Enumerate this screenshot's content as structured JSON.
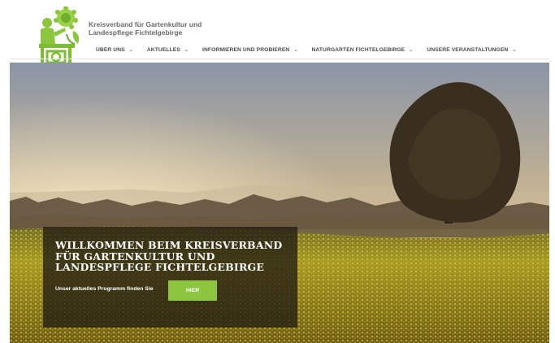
{
  "site": {
    "title_line1": "Kreisverband für Gartenkultur und",
    "title_line2": "Landespflege Fichtelgebirge"
  },
  "nav": {
    "items": [
      {
        "label": "ÜBER UNS"
      },
      {
        "label": "AKTUELLES"
      },
      {
        "label": "INFORMIEREN UND PROBIEREN"
      },
      {
        "label": "NATURGARTEN FICHTELGEBIRGE"
      },
      {
        "label": "UNSERE VERANSTALTUNGEN"
      }
    ],
    "chevron": "⌄"
  },
  "hero": {
    "welcome_title": "WILLKOMMEN BEIM KREISVERBAND FÜR GARTENKULTUR UND LANDESPFLEGE FICHTELGEBIRGE",
    "promo_text": "Unser aktuelles Programm finden Sie",
    "button_label": "HIER"
  },
  "colors": {
    "accent": "#8cc63f",
    "overlay": "#231c12"
  },
  "icons": {
    "logo": "gardener-with-sunflower-logo"
  }
}
